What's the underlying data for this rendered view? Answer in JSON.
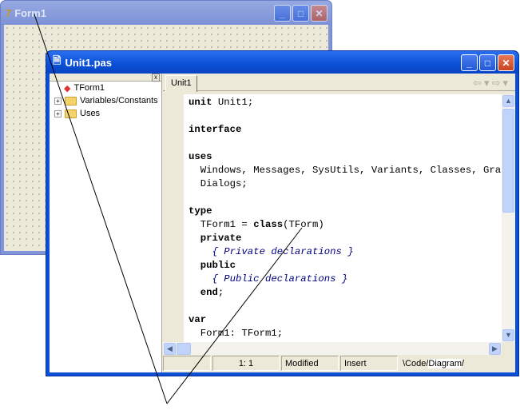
{
  "form1": {
    "title": "Form1"
  },
  "unit": {
    "title": "Unit1.pas"
  },
  "tree": {
    "close": "x",
    "items": [
      "TForm1",
      "Variables/Constants",
      "Uses"
    ]
  },
  "editor": {
    "tab": "Unit1",
    "lines": [
      "unit Unit1;",
      "",
      "interface",
      "",
      "uses",
      "  Windows, Messages, SysUtils, Variants, Classes, Gra",
      "  Dialogs;",
      "",
      "type",
      "  TForm1 = class(TForm)",
      "  private",
      "    { Private declarations }",
      "  public",
      "    { Public declarations }",
      "  end;",
      "",
      "var",
      "  Form1: TForm1;"
    ]
  },
  "status": {
    "position": "1:  1",
    "modified": "Modified",
    "mode": "Insert",
    "tab_code": "Code",
    "tab_diagram": "Diagram"
  }
}
